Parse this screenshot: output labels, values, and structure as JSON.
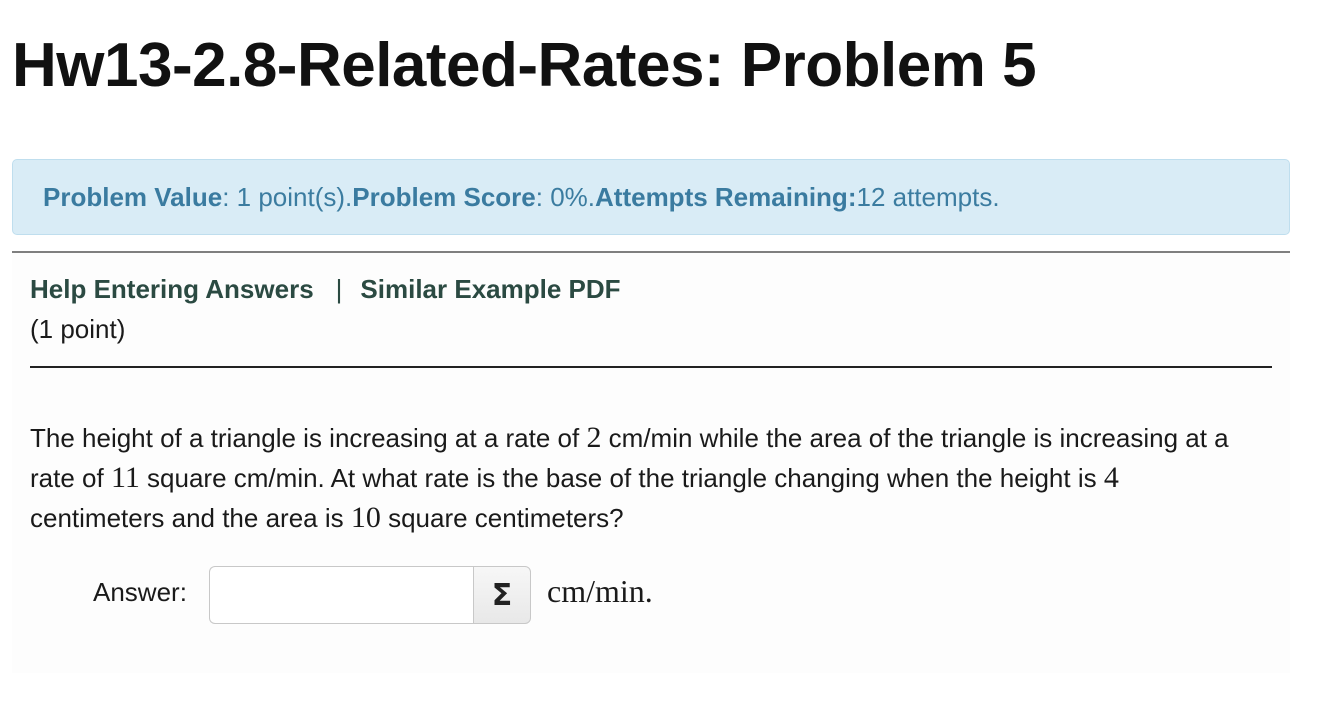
{
  "page": {
    "title": "Hw13-2.8-Related-Rates: Problem 5"
  },
  "info": {
    "value_label": "Problem Value",
    "value_text": ": 1 point(s). ",
    "score_label": "Problem Score",
    "score_text": ": 0%. ",
    "attempts_label": "Attempts Remaining:",
    "attempts_text": " 12 attempts."
  },
  "links": {
    "help": "Help Entering Answers",
    "separator": "|",
    "similar": "Similar Example PDF"
  },
  "problem": {
    "points": "(1 point)",
    "text_1": "The height of a triangle is increasing at a rate of ",
    "n1": "2",
    "text_2": " cm/min while the area of the triangle is increasing at a rate of ",
    "n2": "11",
    "text_3": " square cm/min. At what rate is the base of the triangle changing when the height is ",
    "n3": "4",
    "text_4": " centimeters and the area is ",
    "n4": "10",
    "text_5": " square centimeters?"
  },
  "answer": {
    "label": "Answer:",
    "value": "",
    "placeholder": "",
    "equation_button": "Σ",
    "unit": "cm/min."
  }
}
